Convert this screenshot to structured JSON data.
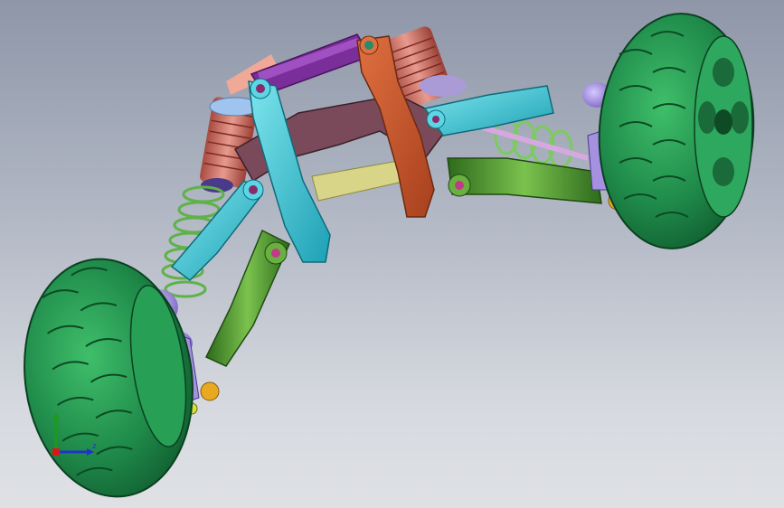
{
  "viewport": {
    "title": "",
    "background_top": "#8e96a8",
    "background_bottom": "#dfe1e5"
  },
  "model": {
    "subject": "rc-car-front-suspension-assembly",
    "colors": {
      "tire": "#1f8a4a",
      "tire_dark": "#0f5a2c",
      "hub": "#a690e0",
      "shock_body": "#d97a6e",
      "shock_cap": "#8fb8e6",
      "spring": "#5fb24a",
      "upper_arm": "#3ec8d6",
      "lower_arm": "#4f8f2e",
      "link": "#7a2e9a",
      "bulkhead": "#7a4a5a",
      "rocker": "#cc5530",
      "cross_bar": "#d8d488",
      "ball_joint": "#e8a820"
    }
  },
  "triad": {
    "x_label": "",
    "y_label": "",
    "z_label": "z",
    "x_color": "#d81818",
    "y_color": "#1c9a1c",
    "z_color": "#2233cc"
  }
}
